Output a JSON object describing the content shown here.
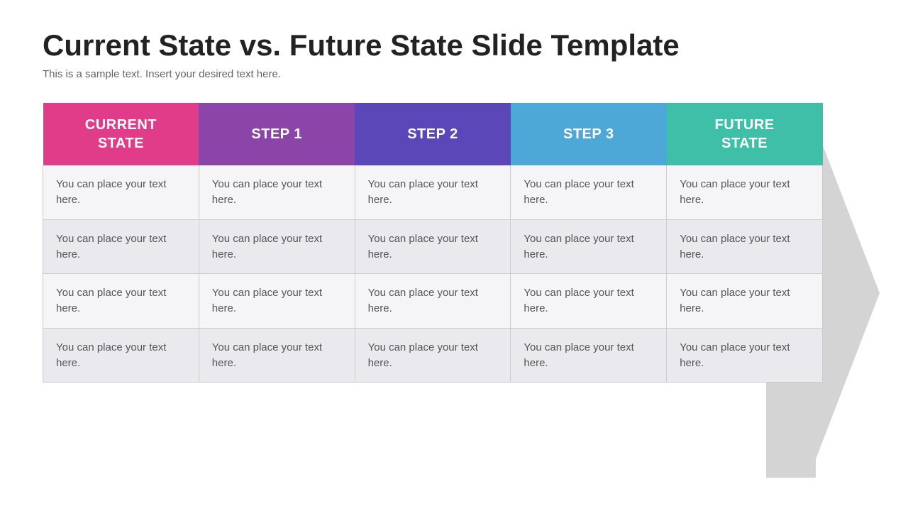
{
  "header": {
    "title": "Current State vs. Future State Slide Template",
    "subtitle": "This is a sample text. Insert your desired text here."
  },
  "table": {
    "columns": [
      {
        "id": "current",
        "label": "CURRENT\nSTATE",
        "class": "col-current"
      },
      {
        "id": "step1",
        "label": "STEP 1",
        "class": "col-step1"
      },
      {
        "id": "step2",
        "label": "STEP 2",
        "class": "col-step2"
      },
      {
        "id": "step3",
        "label": "STEP 3",
        "class": "col-step3"
      },
      {
        "id": "future",
        "label": "FUTURE\nSTATE",
        "class": "col-future"
      }
    ],
    "rows": [
      [
        "You can place your text here.",
        "You can place your text here.",
        "You can place your text here.",
        "You can place your text here.",
        "You can place your text here."
      ],
      [
        "You can place your text here.",
        "You can place your text here.",
        "You can place your text here.",
        "You can place your text here.",
        "You can place your text here."
      ],
      [
        "You can place your text here.",
        "You can place your text here.",
        "You can place your text here.",
        "You can place your text here.",
        "You can place your text here."
      ],
      [
        "You can place your text here.",
        "You can place your text here.",
        "You can place your text here.",
        "You can place your text here.",
        "You can place your text here."
      ]
    ]
  }
}
